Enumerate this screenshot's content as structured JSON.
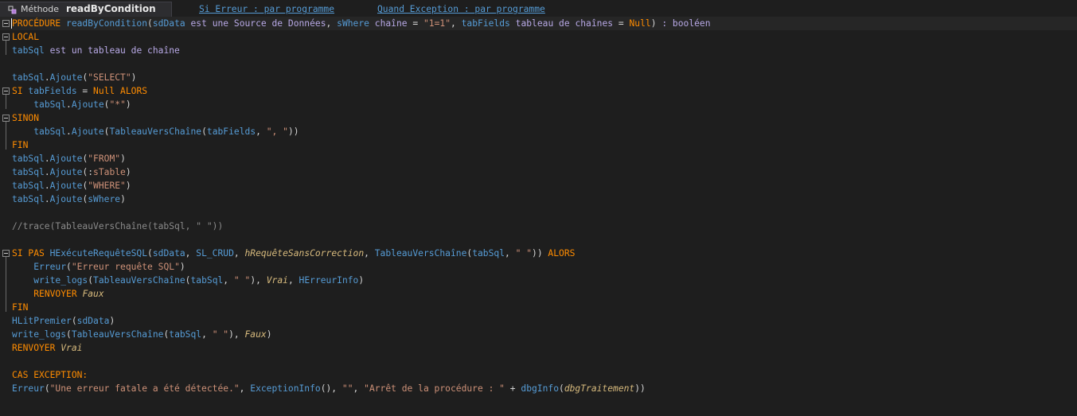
{
  "header": {
    "kind": "Méthode",
    "name": "readByCondition",
    "error_link": "Si Erreur : par programme",
    "exception_link": "Quand Exception : par programme"
  },
  "code_lines": [
    [
      [
        "kw",
        "PROCÉDURE "
      ],
      [
        "id",
        "readByCondition"
      ],
      [
        "pl",
        "("
      ],
      [
        "id",
        "sdData"
      ],
      [
        "pl",
        " "
      ],
      [
        "tp",
        "est une Source de Données"
      ],
      [
        "pl",
        ", "
      ],
      [
        "id",
        "sWhere"
      ],
      [
        "pl",
        " "
      ],
      [
        "tp",
        "chaîne"
      ],
      [
        "pl",
        " = "
      ],
      [
        "str",
        "\"1=1\""
      ],
      [
        "pl",
        ", "
      ],
      [
        "id",
        "tabFields"
      ],
      [
        "pl",
        " "
      ],
      [
        "tp",
        "tableau de chaînes"
      ],
      [
        "pl",
        " = "
      ],
      [
        "kw",
        "Null"
      ],
      [
        "pl",
        ") "
      ],
      [
        "tp",
        ": booléen"
      ]
    ],
    [
      [
        "kw",
        "LOCAL"
      ]
    ],
    [
      [
        "id",
        "tabSql"
      ],
      [
        "pl",
        " "
      ],
      [
        "tp",
        "est un tableau de chaîne"
      ]
    ],
    [],
    [
      [
        "id",
        "tabSql"
      ],
      [
        "pl",
        "."
      ],
      [
        "id",
        "Ajoute"
      ],
      [
        "pl",
        "("
      ],
      [
        "str",
        "\"SELECT\""
      ],
      [
        "pl",
        ")"
      ]
    ],
    [
      [
        "kw",
        "SI "
      ],
      [
        "id",
        "tabFields"
      ],
      [
        "pl",
        " = "
      ],
      [
        "kw",
        "Null ALORS"
      ]
    ],
    [
      [
        "pl",
        "    "
      ],
      [
        "id",
        "tabSql"
      ],
      [
        "pl",
        "."
      ],
      [
        "id",
        "Ajoute"
      ],
      [
        "pl",
        "("
      ],
      [
        "str",
        "\"*\""
      ],
      [
        "pl",
        ")"
      ]
    ],
    [
      [
        "kw",
        "SINON"
      ]
    ],
    [
      [
        "pl",
        "    "
      ],
      [
        "id",
        "tabSql"
      ],
      [
        "pl",
        "."
      ],
      [
        "id",
        "Ajoute"
      ],
      [
        "pl",
        "("
      ],
      [
        "id",
        "TableauVersChaîne"
      ],
      [
        "pl",
        "("
      ],
      [
        "id",
        "tabFields"
      ],
      [
        "pl",
        ", "
      ],
      [
        "str",
        "\", \""
      ],
      [
        "pl",
        "))"
      ]
    ],
    [
      [
        "kw",
        "FIN"
      ]
    ],
    [
      [
        "id",
        "tabSql"
      ],
      [
        "pl",
        "."
      ],
      [
        "id",
        "Ajoute"
      ],
      [
        "pl",
        "("
      ],
      [
        "str",
        "\"FROM\""
      ],
      [
        "pl",
        ")"
      ]
    ],
    [
      [
        "id",
        "tabSql"
      ],
      [
        "pl",
        "."
      ],
      [
        "id",
        "Ajoute"
      ],
      [
        "pl",
        "(:"
      ],
      [
        "str",
        "sTable"
      ],
      [
        "pl",
        ")"
      ]
    ],
    [
      [
        "id",
        "tabSql"
      ],
      [
        "pl",
        "."
      ],
      [
        "id",
        "Ajoute"
      ],
      [
        "pl",
        "("
      ],
      [
        "str",
        "\"WHERE\""
      ],
      [
        "pl",
        ")"
      ]
    ],
    [
      [
        "id",
        "tabSql"
      ],
      [
        "pl",
        "."
      ],
      [
        "id",
        "Ajoute"
      ],
      [
        "pl",
        "("
      ],
      [
        "id",
        "sWhere"
      ],
      [
        "pl",
        ")"
      ]
    ],
    [],
    [
      [
        "cm",
        "//trace(TableauVersChaîne(tabSql, \" \"))"
      ]
    ],
    [],
    [
      [
        "kw",
        "SI PAS "
      ],
      [
        "id",
        "HExécuteRequêteSQL"
      ],
      [
        "pl",
        "("
      ],
      [
        "id",
        "sdData"
      ],
      [
        "pl",
        ", "
      ],
      [
        "id",
        "SL_CRUD"
      ],
      [
        "pl",
        ", "
      ],
      [
        "it",
        "hRequêteSansCorrection"
      ],
      [
        "pl",
        ", "
      ],
      [
        "id",
        "TableauVersChaîne"
      ],
      [
        "pl",
        "("
      ],
      [
        "id",
        "tabSql"
      ],
      [
        "pl",
        ", "
      ],
      [
        "str",
        "\" \""
      ],
      [
        "pl",
        ")) "
      ],
      [
        "kw",
        "ALORS"
      ]
    ],
    [
      [
        "pl",
        "    "
      ],
      [
        "id",
        "Erreur"
      ],
      [
        "pl",
        "("
      ],
      [
        "str",
        "\"Erreur requête SQL\""
      ],
      [
        "pl",
        ")"
      ]
    ],
    [
      [
        "pl",
        "    "
      ],
      [
        "id",
        "write_logs"
      ],
      [
        "pl",
        "("
      ],
      [
        "id",
        "TableauVersChaîne"
      ],
      [
        "pl",
        "("
      ],
      [
        "id",
        "tabSql"
      ],
      [
        "pl",
        ", "
      ],
      [
        "str",
        "\" \""
      ],
      [
        "pl",
        "), "
      ],
      [
        "it",
        "Vrai"
      ],
      [
        "pl",
        ", "
      ],
      [
        "id",
        "HErreurInfo"
      ],
      [
        "pl",
        ")"
      ]
    ],
    [
      [
        "pl",
        "    "
      ],
      [
        "kw",
        "RENVOYER "
      ],
      [
        "it",
        "Faux"
      ]
    ],
    [
      [
        "kw",
        "FIN"
      ]
    ],
    [
      [
        "id",
        "HLitPremier"
      ],
      [
        "pl",
        "("
      ],
      [
        "id",
        "sdData"
      ],
      [
        "pl",
        ")"
      ]
    ],
    [
      [
        "id",
        "write_logs"
      ],
      [
        "pl",
        "("
      ],
      [
        "id",
        "TableauVersChaîne"
      ],
      [
        "pl",
        "("
      ],
      [
        "id",
        "tabSql"
      ],
      [
        "pl",
        ", "
      ],
      [
        "str",
        "\" \""
      ],
      [
        "pl",
        "), "
      ],
      [
        "it",
        "Faux"
      ],
      [
        "pl",
        ")"
      ]
    ],
    [
      [
        "kw",
        "RENVOYER "
      ],
      [
        "it",
        "Vrai"
      ]
    ],
    [],
    [
      [
        "kw",
        "CAS EXCEPTION:"
      ]
    ],
    [
      [
        "id",
        "Erreur"
      ],
      [
        "pl",
        "("
      ],
      [
        "str",
        "\"Une erreur fatale a été détectée.\""
      ],
      [
        "pl",
        ", "
      ],
      [
        "id",
        "ExceptionInfo"
      ],
      [
        "pl",
        "(), "
      ],
      [
        "str",
        "\"\""
      ],
      [
        "pl",
        ", "
      ],
      [
        "str",
        "\"Arrêt de la procédure : \""
      ],
      [
        "pl",
        " + "
      ],
      [
        "id",
        "dbgInfo"
      ],
      [
        "pl",
        "("
      ],
      [
        "it",
        "dbgTraitement"
      ],
      [
        "pl",
        "))"
      ]
    ]
  ]
}
